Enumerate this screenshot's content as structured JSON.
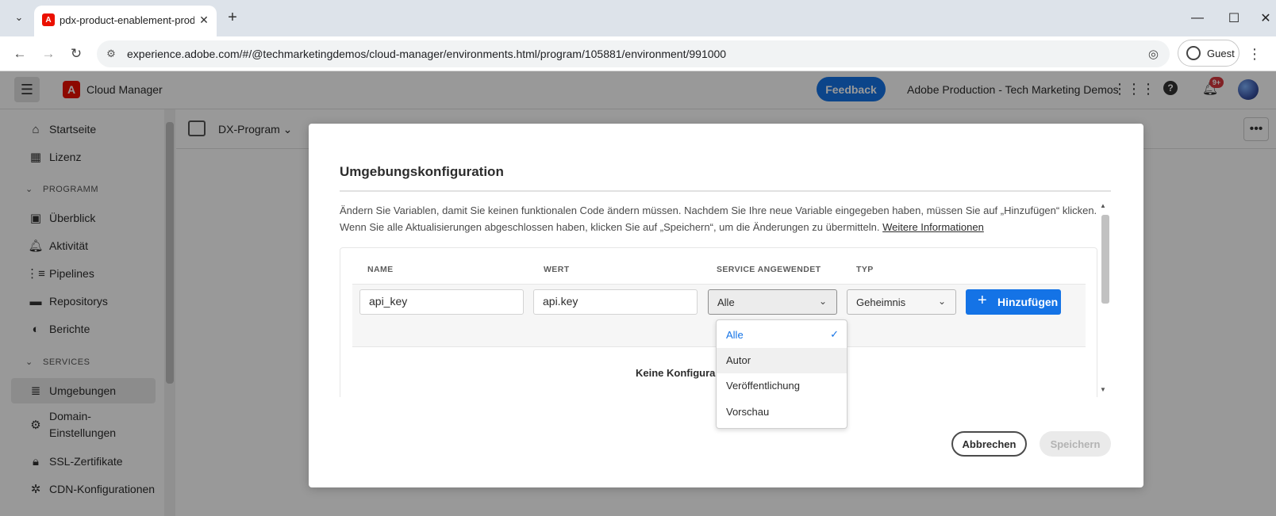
{
  "browser": {
    "tab_title": "pdx-product-enablement-prod",
    "url": "experience.adobe.com/#/@techmarketingdemos/cloud-manager/environments.html/program/105881/environment/991000",
    "guest_label": "Guest"
  },
  "appbar": {
    "app_name": "Cloud Manager",
    "feedback_label": "Feedback",
    "org_name": "Adobe Production - Tech Marketing Demos",
    "notification_count": "9+"
  },
  "sidebar": {
    "items_top": [
      {
        "label": "Startseite",
        "icon": "home-icon"
      },
      {
        "label": "Lizenz",
        "icon": "license-icon"
      }
    ],
    "section_program": "PROGRAMM",
    "items_program": [
      {
        "label": "Überblick",
        "icon": "overview-icon"
      },
      {
        "label": "Aktivität",
        "icon": "bell-icon"
      },
      {
        "label": "Pipelines",
        "icon": "pipeline-icon"
      },
      {
        "label": "Repositorys",
        "icon": "folder-icon"
      },
      {
        "label": "Berichte",
        "icon": "chart-icon"
      }
    ],
    "section_services": "SERVICES",
    "items_services": [
      {
        "label": "Umgebungen",
        "icon": "database-icon",
        "active": true
      },
      {
        "label_line1": "Domain-",
        "label_line2": "Einstellungen",
        "icon": "gear-icon"
      },
      {
        "label": "SSL-Zertifikate",
        "icon": "lock-icon"
      },
      {
        "label": "CDN-Konfigurationen",
        "icon": "network-icon"
      }
    ]
  },
  "content_header": {
    "program_name": "DX-Program"
  },
  "dialog": {
    "title": "Umgebungskonfiguration",
    "description": "Ändern Sie Variablen, damit Sie keinen funktionalen Code ändern müssen. Nachdem Sie Ihre neue Variable eingegeben haben, müssen Sie auf „Hinzufügen“ klicken. Wenn Sie alle Aktualisierungen abgeschlossen haben, klicken Sie auf „Speichern“, um die Änderungen zu übermitteln.",
    "more_info_link": "Weitere Informationen",
    "columns": [
      "NAME",
      "WERT",
      "SERVICE ANGEWENDET",
      "TYP"
    ],
    "new_row": {
      "name_value": "api_key",
      "value_value": "api.key",
      "service_selected": "Alle",
      "type_selected": "Geheimnis"
    },
    "add_label": "Hinzufügen",
    "empty_message": "Keine Konfigura",
    "service_options": [
      {
        "label": "Alle",
        "selected": true
      },
      {
        "label": "Autor",
        "hover": true
      },
      {
        "label": "Veröffentlichung"
      },
      {
        "label": "Vorschau"
      }
    ],
    "cancel_label": "Abbrechen",
    "save_label": "Speichern"
  },
  "colors": {
    "accent": "#1473e6",
    "brand_red": "#eb1000",
    "badge_red": "#d7373f"
  }
}
